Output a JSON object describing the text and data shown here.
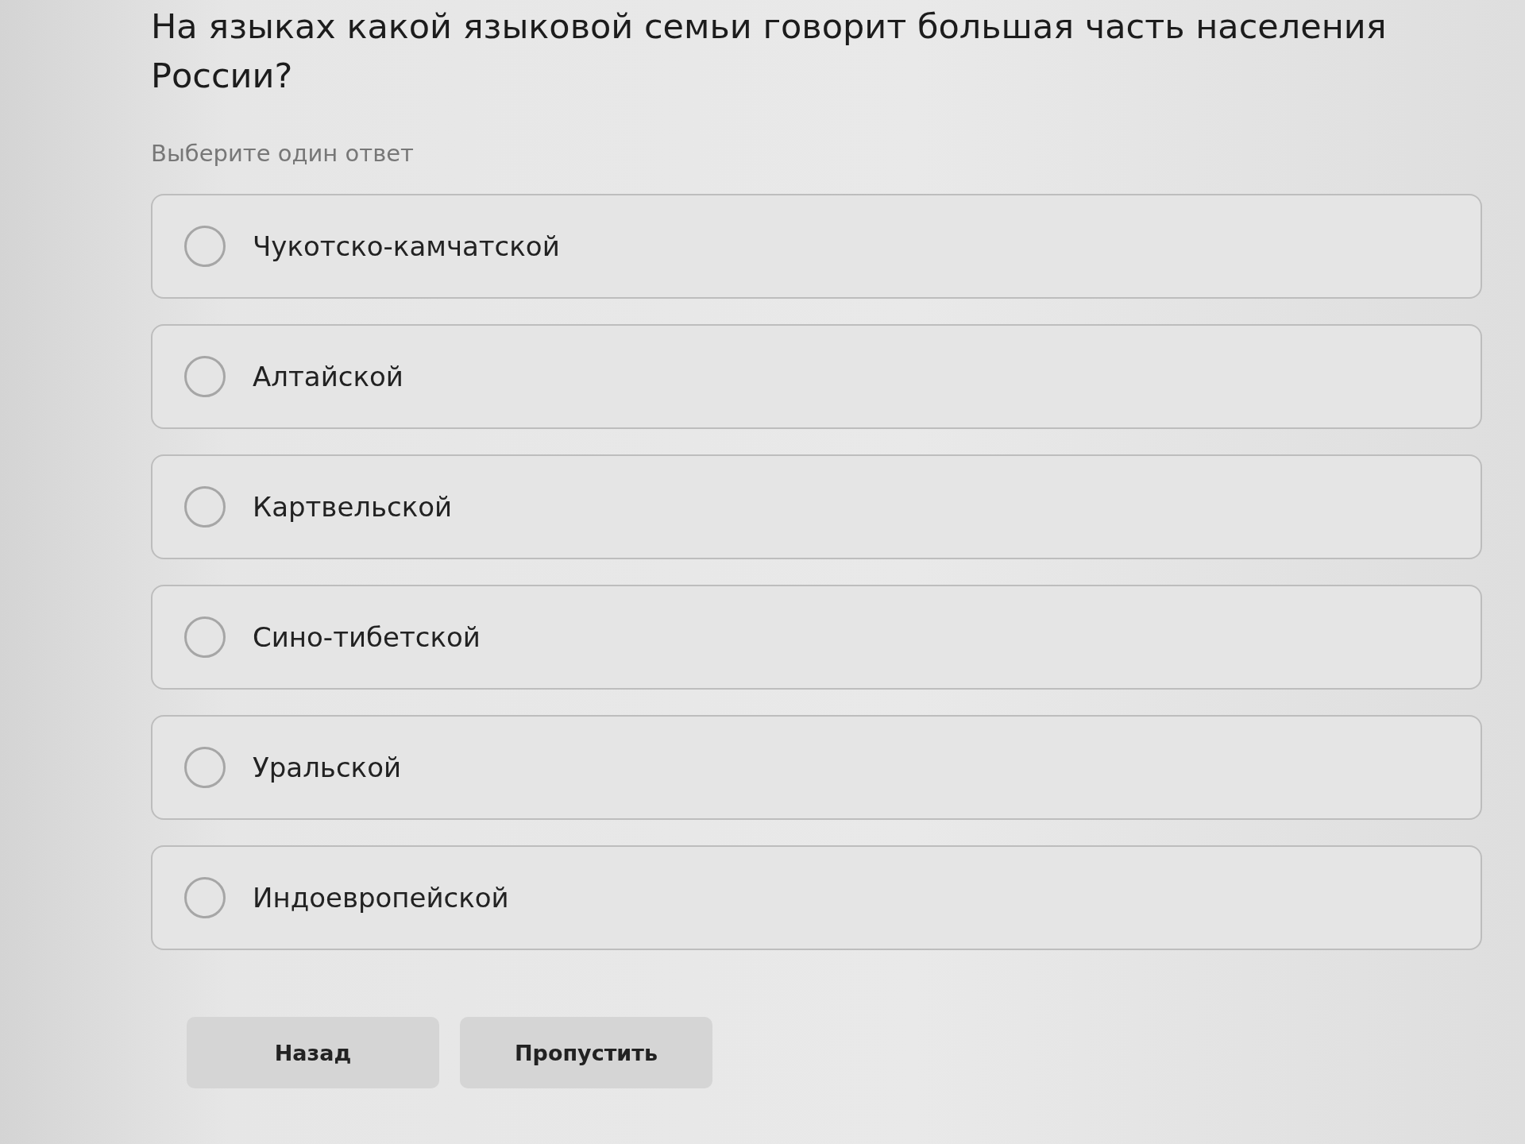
{
  "question": {
    "text": "На языках какой языковой семьи говорит большая часть населения России?",
    "hint": "Выберите один ответ"
  },
  "options": [
    {
      "label": "Чукотско-камчатской",
      "selected": false
    },
    {
      "label": "Алтайской",
      "selected": false
    },
    {
      "label": "Картвельской",
      "selected": false
    },
    {
      "label": "Сино-тибетской",
      "selected": false
    },
    {
      "label": "Уральской",
      "selected": false
    },
    {
      "label": "Индоевропейской",
      "selected": false
    }
  ],
  "buttons": [
    {
      "label": "Назад"
    },
    {
      "label": "Пропустить"
    }
  ]
}
